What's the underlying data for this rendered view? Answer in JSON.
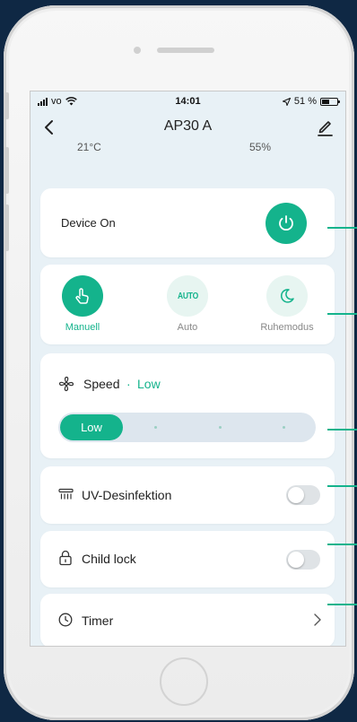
{
  "status_bar": {
    "carrier": "vo",
    "time": "14:01",
    "battery": "51 %",
    "battery_level": 0.51
  },
  "header": {
    "title": "AP30 A"
  },
  "readings": {
    "left": "21°C",
    "right": "55%"
  },
  "device": {
    "label": "Device On"
  },
  "modes": [
    {
      "label": "Manuell",
      "icon": "hand-pointer-icon",
      "active": true
    },
    {
      "label": "Auto",
      "icon_text": "AUTO",
      "active": false
    },
    {
      "label": "Ruhemodus",
      "icon": "moon-icon",
      "active": false
    }
  ],
  "speed": {
    "title": "Speed",
    "separator": "·",
    "value": "Low",
    "slider_label": "Low",
    "level": 1,
    "levels": 4
  },
  "uv": {
    "label": "UV-Desinfektion",
    "on": false
  },
  "child_lock": {
    "label": "Child lock",
    "on": false
  },
  "timer": {
    "label": "Timer"
  },
  "colors": {
    "accent": "#14b38c",
    "screen_bg": "#e8f1f6",
    "frame_bg": "#0f2844"
  }
}
